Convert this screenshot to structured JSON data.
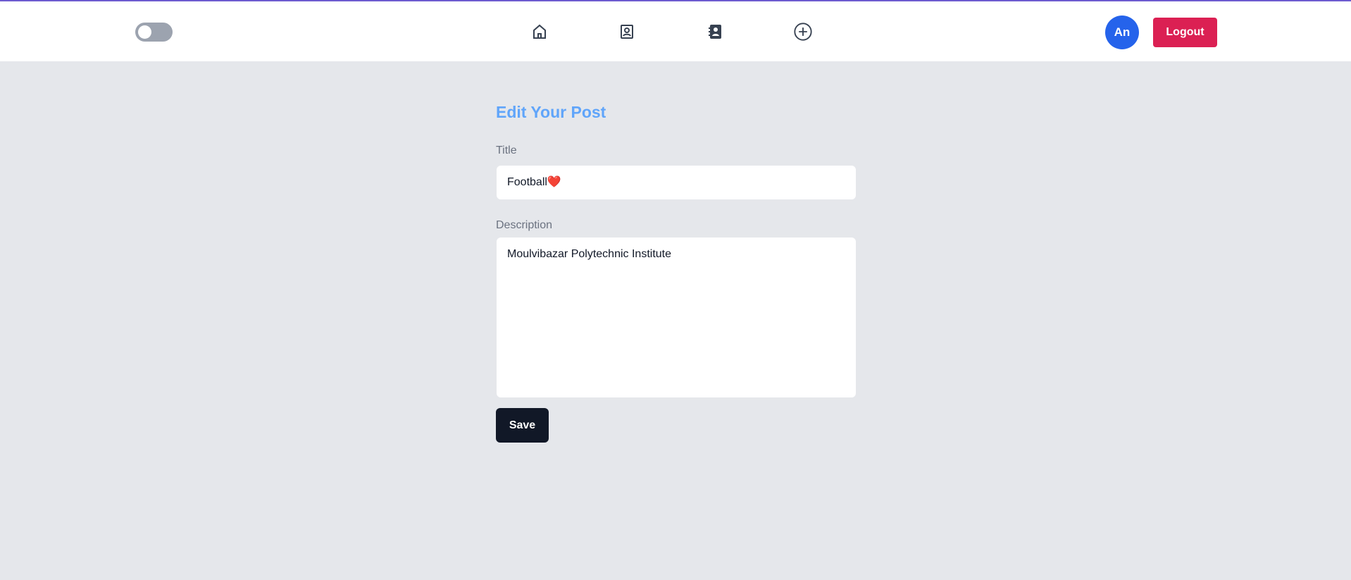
{
  "nav": {
    "avatar_initials": "An",
    "logout_label": "Logout"
  },
  "form": {
    "heading": "Edit Your Post",
    "title_label": "Title",
    "title_value": "Football❤️",
    "description_label": "Description",
    "description_value": "Moulvibazar Polytechnic Institute",
    "save_label": "Save"
  },
  "colors": {
    "accent": "#60a5fa",
    "logout": "#db2053",
    "avatar": "#2563eb",
    "save": "#111827"
  }
}
